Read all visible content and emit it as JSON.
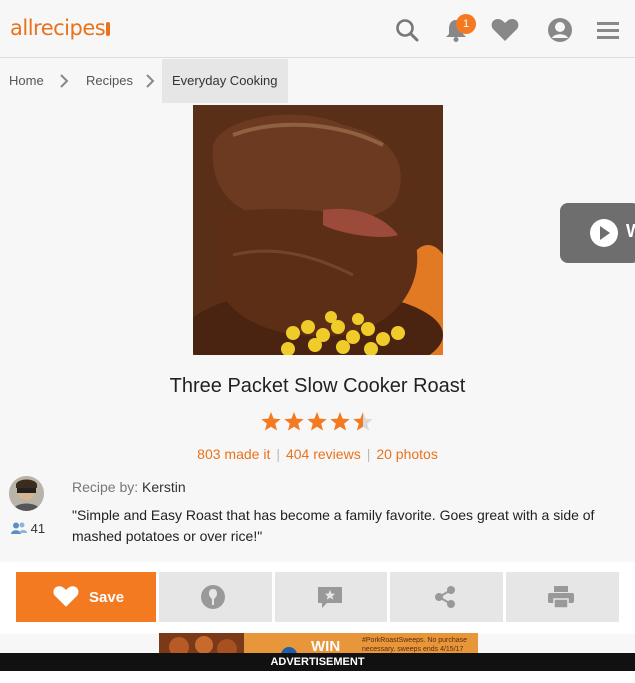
{
  "header": {
    "logo_text": "allrecipes",
    "notification_count": "1",
    "icons": [
      "search-icon",
      "bell-icon",
      "heart-icon",
      "user-icon",
      "menu-icon"
    ]
  },
  "breadcrumb": {
    "items": [
      "Home",
      "Recipes",
      "Everyday Cooking"
    ]
  },
  "video_tab": {
    "label": "W"
  },
  "recipe": {
    "title": "Three Packet Slow Cooker Roast",
    "rating": 4.5,
    "rating_max": 5,
    "made_it": "803 made it",
    "reviews": "404 reviews",
    "photos": "20 photos",
    "author_prefix": "Recipe by:",
    "author": "Kerstin",
    "followers": "41",
    "description": "\"Simple and Easy Roast that has become a family favorite. Goes great with a side of mashed potatoes or over rice!\""
  },
  "actions": {
    "save_label": "Save",
    "icons": [
      "pin-icon",
      "review-icon",
      "share-icon",
      "print-icon"
    ]
  },
  "ad": {
    "headline": "WIN",
    "fine_print": "#PorkRoastSweeps. No purchase necessary. sweeps ends 4/15/17",
    "label": "ADVERTISEMENT"
  },
  "colors": {
    "brand": "#f47a21",
    "star": "#f47a21",
    "background": "#f7f7f7"
  }
}
